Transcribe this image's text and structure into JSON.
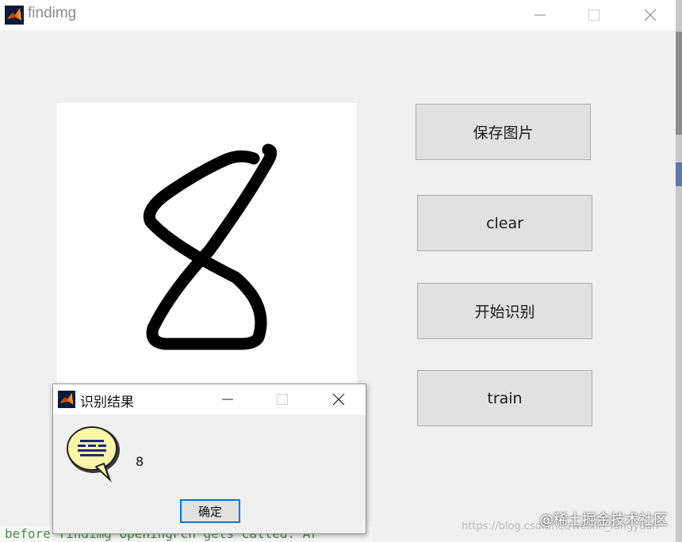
{
  "main_window": {
    "title": "findimg",
    "colors": {
      "titlebar_bg": "#ffffff",
      "window_bg": "#f0f0f0",
      "button_bg": "#e1e1e1",
      "button_border": "#adadad"
    },
    "buttons": {
      "save": "保存图片",
      "clear": "clear",
      "recognize": "开始识别",
      "train": "train"
    },
    "canvas": {
      "drawn_digit": "8",
      "stroke_color": "#000000"
    }
  },
  "console": {
    "text": "before findimg OpeningFcn gets called. Ar"
  },
  "dialog": {
    "title": "识别结果",
    "result": "8",
    "ok_label": "确定",
    "accent": "#0078d7"
  },
  "watermark": {
    "main": "@稀土掘金技术社区",
    "url": "https://blog.csdn.net/weixin_fangyuan"
  }
}
